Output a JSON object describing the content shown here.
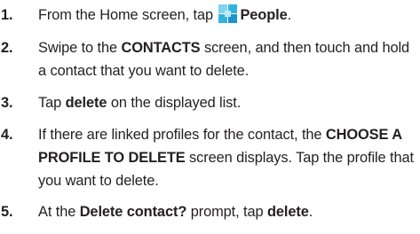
{
  "steps": [
    {
      "number": "1.",
      "t1": "From the Home screen, tap ",
      "icon": "people-app-icon",
      "b1": "People",
      "t2": "."
    },
    {
      "number": "2.",
      "t1": "Swipe to the ",
      "b1": "CONTACTS",
      "t2": " screen, and then touch and hold a contact that you want to delete."
    },
    {
      "number": "3.",
      "t1": "Tap ",
      "b1": "delete",
      "t2": " on the displayed list."
    },
    {
      "number": "4.",
      "t1": "If there are linked profiles for the contact, the ",
      "b1": "CHOOSE A PROFILE TO DELETE",
      "t2": " screen displays. Tap the profile that you want to delete."
    },
    {
      "number": "5.",
      "t1": "At the ",
      "b1": "Delete contact?",
      "t2": " prompt, tap ",
      "b2": "delete",
      "t3": "."
    }
  ],
  "colors": {
    "text": "#231f20",
    "icon_light": "#7fd3ef",
    "icon_mid": "#31b3e2",
    "icon_dark": "#1a93cf"
  }
}
